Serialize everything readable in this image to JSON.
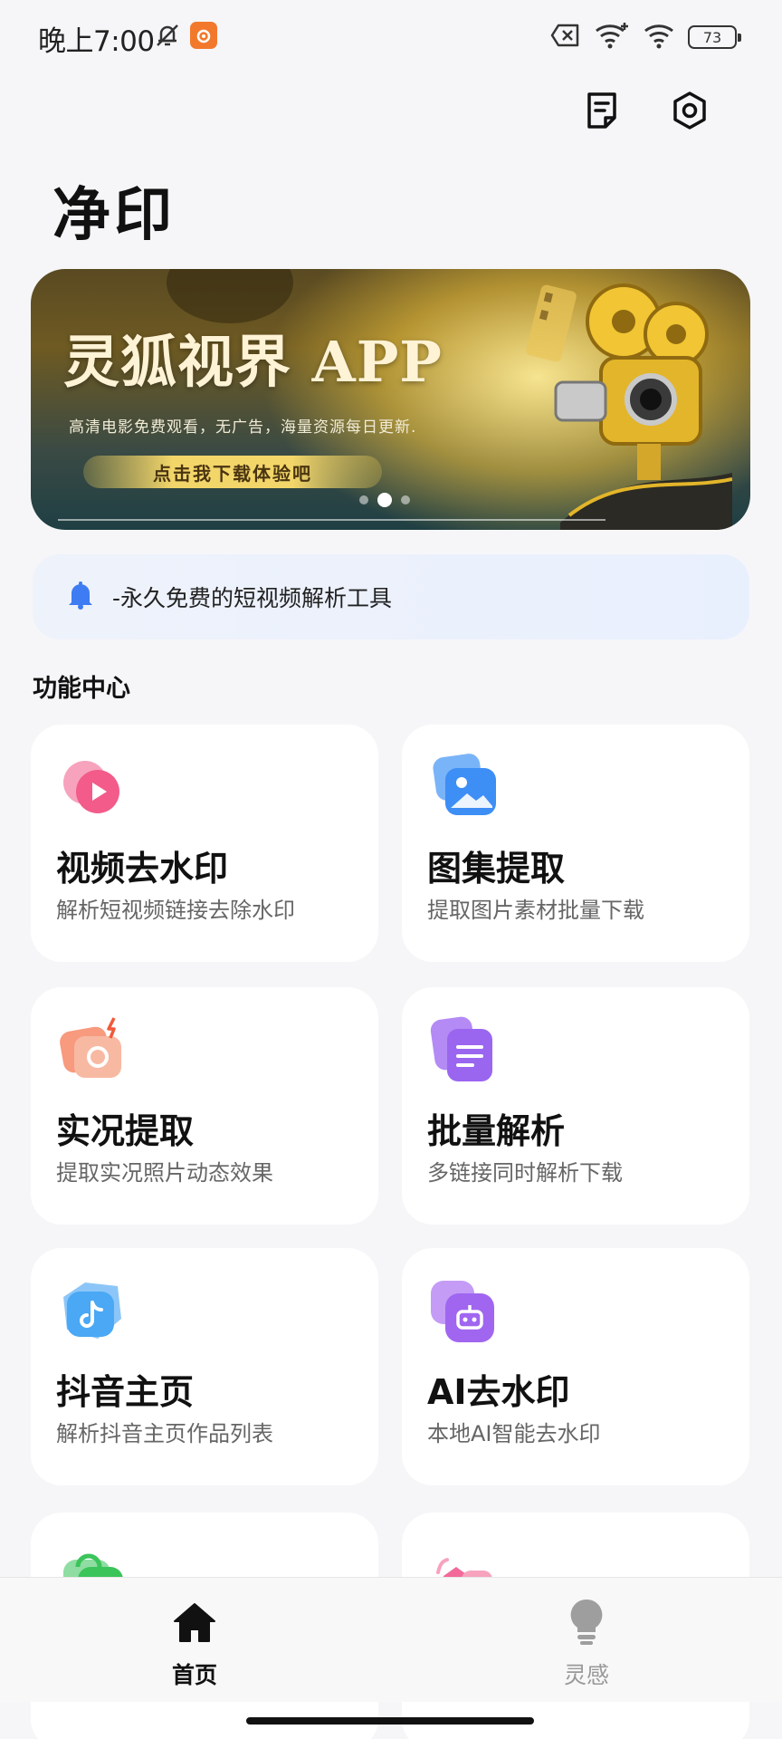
{
  "status_bar": {
    "time": "晚上7:00",
    "battery": "73"
  },
  "app": {
    "title": "净印"
  },
  "banner": {
    "title": "灵狐视界 APP",
    "subtitle": "高清电影免费观看，无广告，海量资源每日更新.",
    "cta": "点击我下载体验吧",
    "active_slide": 2,
    "slide_count": 3
  },
  "notice": {
    "text": "-永久免费的短视频解析工具"
  },
  "section": {
    "title": "功能中心"
  },
  "features": [
    {
      "title": "视频去水印",
      "desc": "解析短视频链接去除水印",
      "icon": "video-play-icon",
      "color": "#f25b8a"
    },
    {
      "title": "图集提取",
      "desc": "提取图片素材批量下载",
      "icon": "image-gallery-icon",
      "color": "#3d8ef5"
    },
    {
      "title": "实况提取",
      "desc": "提取实况照片动态效果",
      "icon": "live-camera-icon",
      "color": "#f57a5a"
    },
    {
      "title": "批量解析",
      "desc": "多链接同时解析下载",
      "icon": "document-stack-icon",
      "color": "#9a66f0"
    },
    {
      "title": "抖音主页",
      "desc": "解析抖音主页作品列表",
      "icon": "douyin-icon",
      "color": "#4aa8f5"
    },
    {
      "title": "AI去水印",
      "desc": "本地AI智能去水印",
      "icon": "ai-robot-icon",
      "color": "#a066f0"
    },
    {
      "title": "",
      "desc": "",
      "icon": "green-bag-icon",
      "color": "#3bc45a"
    },
    {
      "title": "",
      "desc": "",
      "icon": "pink-speaker-icon",
      "color": "#f26a9a"
    }
  ],
  "nav": {
    "home": "首页",
    "inspiration": "灵感",
    "active": "home"
  },
  "colors": {
    "background": "#f6f6f8",
    "notice_bell": "#3d7cf2",
    "nav_active": "#111111",
    "nav_inactive": "#999999"
  }
}
